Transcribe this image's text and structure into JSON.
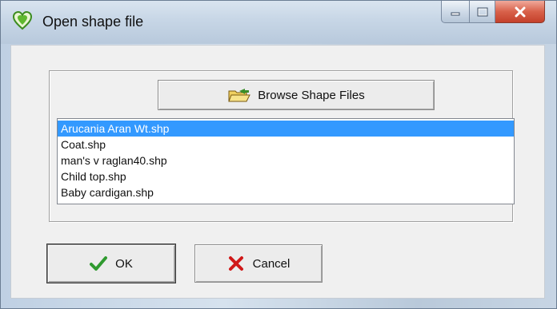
{
  "window": {
    "title": "Open shape file",
    "icon": "heart-shape-icon",
    "caption_buttons": [
      "minimize",
      "maximize",
      "close"
    ]
  },
  "browse_button": {
    "label": "Browse Shape Files",
    "icon": "open-folder-icon"
  },
  "shape_files": {
    "items": [
      "Arucania Aran Wt.shp",
      "Coat.shp",
      "man's v raglan40.shp",
      "Child top.shp",
      "Baby cardigan.shp"
    ],
    "selected_index": 0
  },
  "buttons": {
    "ok_label": "OK",
    "ok_icon": "checkmark-icon",
    "cancel_label": "Cancel",
    "cancel_icon": "red-x-icon"
  },
  "colors": {
    "selection": "#3399ff",
    "ok_check": "#2f9a2f",
    "cancel_x": "#d01818"
  }
}
